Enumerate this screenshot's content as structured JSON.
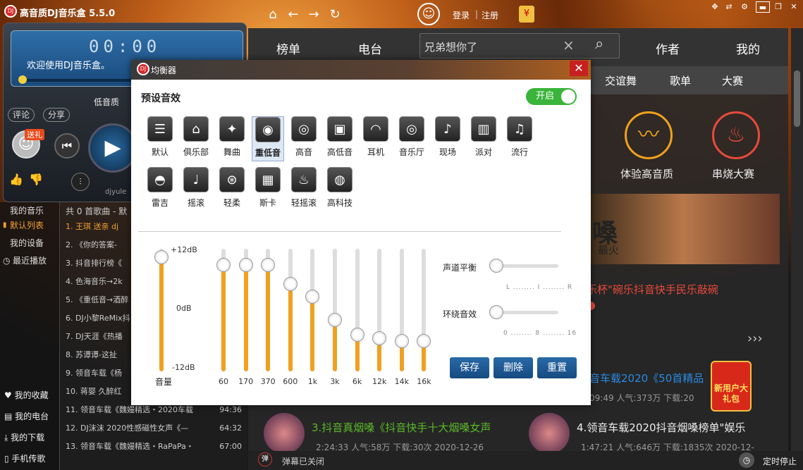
{
  "app": {
    "title": "高音质DJ音乐盒 5.5.0",
    "logo": "DJ"
  },
  "top": {
    "login": "登录",
    "separator": "|",
    "register": "注册"
  },
  "player": {
    "time": "00:00",
    "welcome": "欢迎使用DJ音乐盒。",
    "progress": 0,
    "comment": "评论",
    "share": "分享",
    "bass": "低音质",
    "gift": "送礼",
    "brand": "djyule"
  },
  "sidebar": {
    "items": [
      {
        "label": "我的音乐",
        "active": false
      },
      {
        "label": "默认列表",
        "active": true
      },
      {
        "label": "我的设备",
        "active": false
      },
      {
        "label": "最近播放",
        "active": false
      }
    ],
    "bottom": [
      {
        "label": "我的收藏"
      },
      {
        "label": "我的电台"
      },
      {
        "label": "我的下载"
      },
      {
        "label": "手机传歌"
      }
    ]
  },
  "playlist": {
    "header": "共 0 首歌曲 - 默",
    "rows": [
      {
        "title": "1. 王琪 送亲 dj",
        "duration": "",
        "playing": true
      },
      {
        "title": "2. 《你的答案-",
        "duration": ""
      },
      {
        "title": "3. 抖音排行榜《",
        "duration": ""
      },
      {
        "title": "4. 色海音乐→2k",
        "duration": ""
      },
      {
        "title": "5. 《重低音→酒醉",
        "duration": ""
      },
      {
        "title": "6. DJ小黎ReMix抖",
        "duration": ""
      },
      {
        "title": "7. DJ天涯《热播",
        "duration": ""
      },
      {
        "title": "8. 苏谭谭-这扯",
        "duration": ""
      },
      {
        "title": "9. 领音车载《杨",
        "duration": ""
      },
      {
        "title": "10. 蒋婴 久醉红",
        "duration": ""
      },
      {
        "title": "11. 领音车载《魏嫚精选・2020车载",
        "duration": "94:36"
      },
      {
        "title": "12. DJ沫沫 2020性感磁性女声《—",
        "duration": "64:32"
      },
      {
        "title": "13. 领音车载《魏嫚精选・RaPaPa・",
        "duration": "67:00"
      }
    ]
  },
  "main": {
    "tabs": [
      "榜单",
      "电台",
      "作者",
      "我的"
    ],
    "search_placeholder": "兄弟想你了",
    "subtabs": [
      "交谊舞",
      "歌单",
      "大赛"
    ],
    "features": [
      {
        "label": "体验高音质",
        "color": "#f0a020",
        "icon": "sound-wave-icon"
      },
      {
        "label": "串烧大赛",
        "color": "#e84a3a",
        "icon": "flame-icon"
      }
    ],
    "banner_title": "嗓",
    "banner_sub": "最火",
    "hot_title": "乐杯\"碗乐抖音快手民乐敲碗",
    "songs": [
      {
        "title": "音车载2020《50首精品",
        "meta": "09:49  人气:373万  下载:20",
        "highlight": true
      },
      {
        "title": "3.抖音真烟嗓《抖音快手十大烟嗓女声",
        "meta": "2:24:33  人气:58万  下载:30次  2020-12-26",
        "highlight": true
      },
      {
        "title": "4.领音车载2020抖音烟嗓榜单\"娱乐",
        "meta": "1:47:21  人气:646万  下载:1835次  2020-12-",
        "highlight": false
      }
    ],
    "new_user": "新用户大礼包"
  },
  "bottom": {
    "danmu": "弹幕已关闭",
    "timer": "定时停止"
  },
  "eq": {
    "title": "均衡器",
    "preset_label": "预设音效",
    "toggle": "开启",
    "presets": [
      {
        "label": "默认",
        "icon": "sliders-icon"
      },
      {
        "label": "俱乐部",
        "icon": "house-icon"
      },
      {
        "label": "舞曲",
        "icon": "dancer-icon"
      },
      {
        "label": "重低音",
        "icon": "speaker-icon",
        "selected": true
      },
      {
        "label": "高音",
        "icon": "disc-icon"
      },
      {
        "label": "高低音",
        "icon": "speaker-box-icon"
      },
      {
        "label": "耳机",
        "icon": "headphones-icon"
      },
      {
        "label": "音乐厅",
        "icon": "cd-icon"
      },
      {
        "label": "现场",
        "icon": "microphone-icon"
      },
      {
        "label": "派对",
        "icon": "beer-icon"
      },
      {
        "label": "流行",
        "icon": "mic-stand-icon"
      },
      {
        "label": "雷吉",
        "icon": "cap-icon"
      },
      {
        "label": "摇滚",
        "icon": "guitar-icon"
      },
      {
        "label": "轻柔",
        "icon": "acoustic-guitar-icon"
      },
      {
        "label": "斯卡",
        "icon": "keyboard-icon"
      },
      {
        "label": "轻摇滚",
        "icon": "fire-icon"
      },
      {
        "label": "高科技",
        "icon": "balloon-icon"
      }
    ],
    "db_top": "+12dB",
    "db_mid": "0dB",
    "db_bottom": "-12dB",
    "volume_label": "音量",
    "volume": 0.93,
    "bands": [
      {
        "freq": "60",
        "level": 0.87
      },
      {
        "freq": "170",
        "level": 0.87
      },
      {
        "freq": "370",
        "level": 0.87
      },
      {
        "freq": "600",
        "level": 0.71
      },
      {
        "freq": "1k",
        "level": 0.61
      },
      {
        "freq": "3k",
        "level": 0.42
      },
      {
        "freq": "6k",
        "level": 0.3
      },
      {
        "freq": "12k",
        "level": 0.27
      },
      {
        "freq": "14k",
        "level": 0.25
      },
      {
        "freq": "16k",
        "level": 0.25
      }
    ],
    "balance_label": "声道平衡",
    "balance_scale": "L ........ I ........ R",
    "balance": 0.0,
    "surround_label": "环绕音效",
    "surround_scale": "0 ........ 8 ........ 16",
    "surround": 0.0,
    "buttons": {
      "save": "保存",
      "delete": "删除",
      "reset": "重置"
    }
  }
}
